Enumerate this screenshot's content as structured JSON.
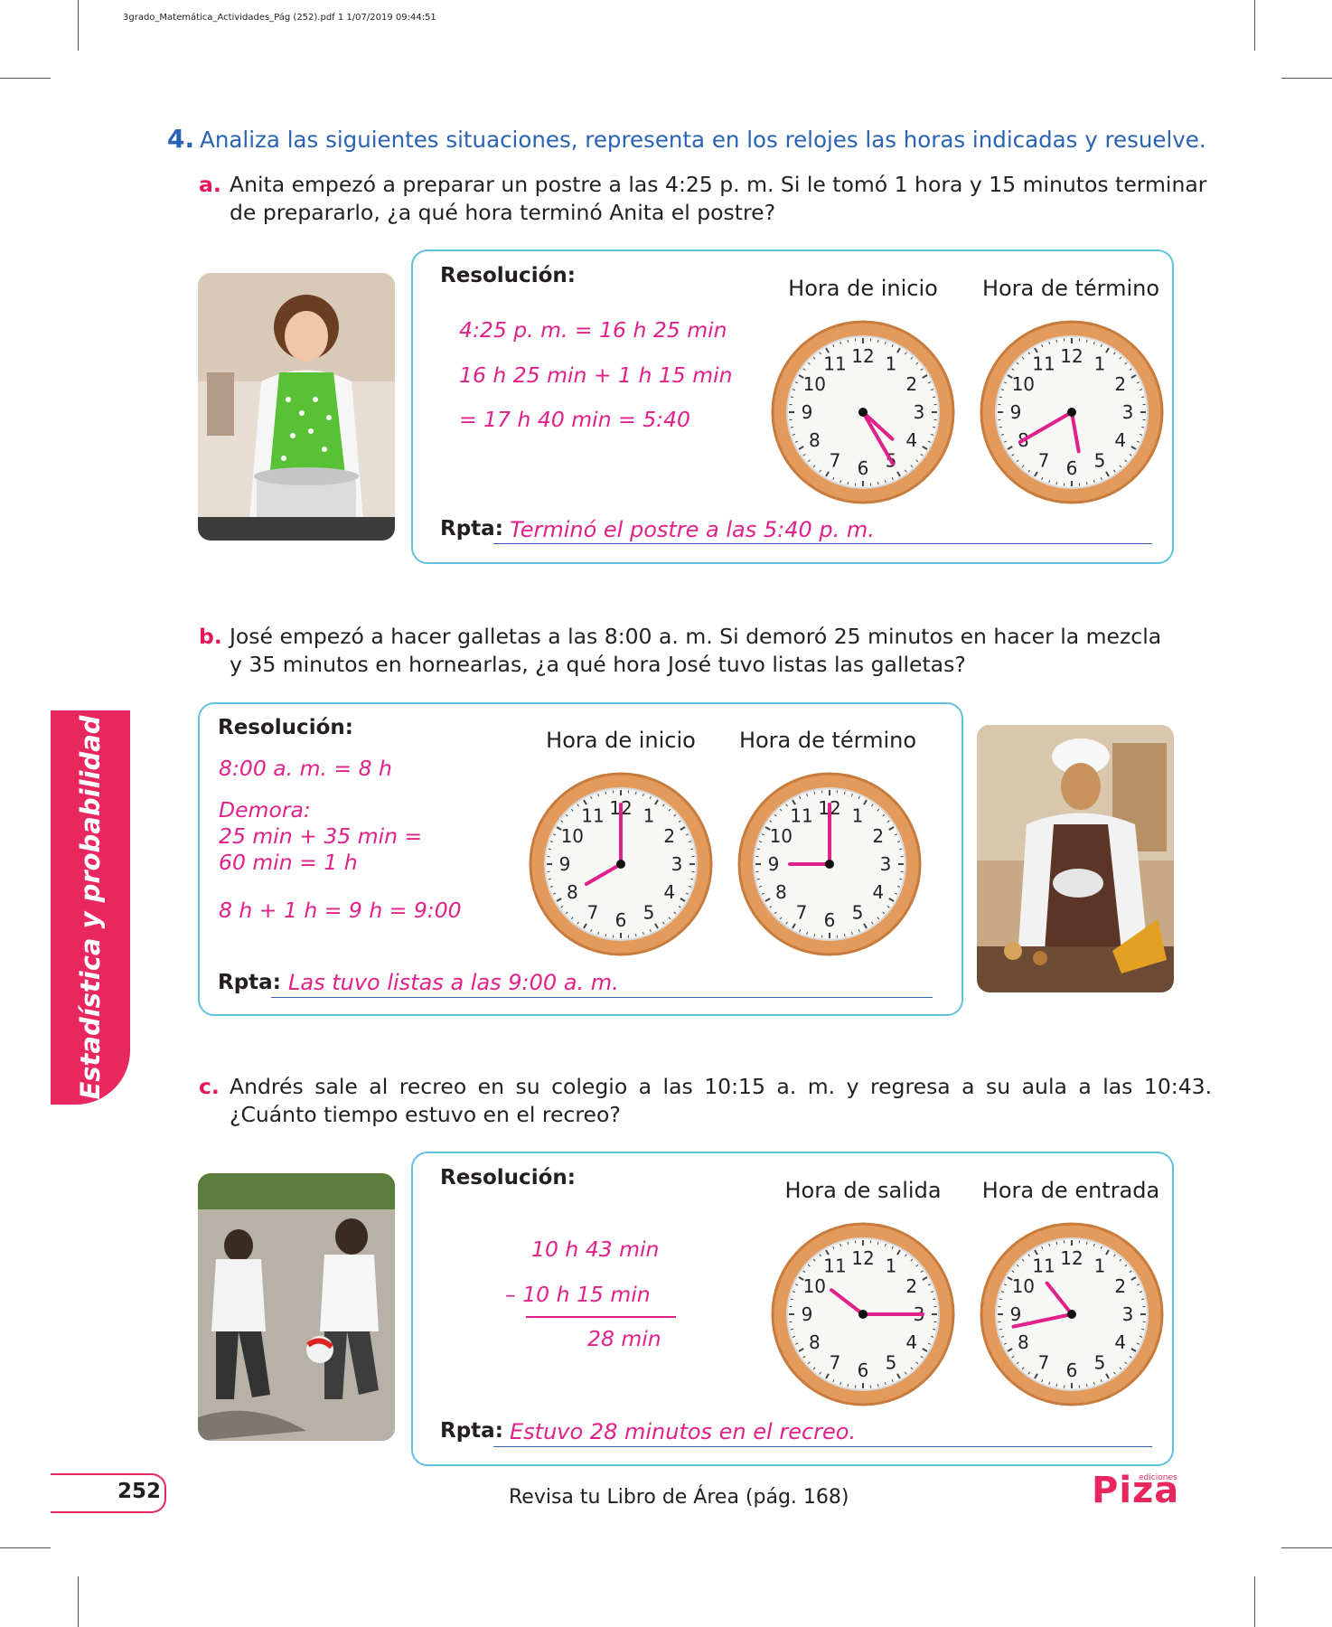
{
  "header_meta": "3grado_Matemática_Actividades_Pág (252).pdf   1   1/07/2019   09:44:51",
  "question": {
    "number": "4.",
    "title": "Analiza las siguientes situaciones, representa en los relojes las horas indicadas y resuelve."
  },
  "items": [
    {
      "letter": "a.",
      "statement_1": "Anita empezó a preparar un postre a las 4:25 p. m. Si le tomó 1 hora y 15 minutos terminar",
      "statement_2": "de prepararlo, ¿a qué hora terminó Anita el postre?",
      "resolution_label": "Resolución:",
      "work": [
        "4:25 p. m. = 16 h 25 min",
        "16 h 25 min + 1 h 15 min",
        "= 17 h 40 min = 5:40"
      ],
      "clock_1": {
        "caption": "Hora de inicio",
        "hour": 4,
        "minute": 25
      },
      "clock_2": {
        "caption": "Hora de término",
        "hour": 5,
        "minute": 40
      },
      "answer_label": "Rpta:",
      "answer": "Terminó el postre a las 5:40 p. m."
    },
    {
      "letter": "b.",
      "statement_1": "José empezó a hacer galletas a las 8:00 a. m. Si demoró 25 minutos en hacer la mezcla",
      "statement_2": "y 35 minutos en hornearlas, ¿a qué hora José tuvo listas las galletas?",
      "resolution_label": "Resolución:",
      "work": [
        "8:00 a. m. = 8 h",
        "Demora:",
        "25 min + 35 min =",
        "60 min = 1 h",
        "8 h + 1 h = 9 h = 9:00"
      ],
      "clock_1": {
        "caption": "Hora de inicio",
        "hour": 8,
        "minute": 0
      },
      "clock_2": {
        "caption": "Hora de término",
        "hour": 9,
        "minute": 0
      },
      "answer_label": "Rpta:",
      "answer": "Las tuvo listas a las 9:00 a. m."
    },
    {
      "letter": "c.",
      "statement_1": "Andrés sale al recreo en su colegio a las 10:15 a. m. y regresa a su aula a las 10:43.",
      "statement_2": "¿Cuánto tiempo estuvo en el recreo?",
      "resolution_label": "Resolución:",
      "work": [
        "10 h  43 min",
        "–  10 h  15 min",
        "28 min"
      ],
      "clock_1": {
        "caption": "Hora de salida",
        "hour": 10,
        "minute": 15
      },
      "clock_2": {
        "caption": "Hora de entrada",
        "hour": 10,
        "minute": 43
      },
      "answer_label": "Rpta:",
      "answer": "Estuvo 28 minutos en el recreo."
    }
  ],
  "side_tab": "Estadística y probabilidad",
  "page_number": "252",
  "footer": "Revisa tu Libro de Área (pág. 168)",
  "logo": {
    "word": "Piza",
    "sub": "ediciones"
  },
  "colors": {
    "accent_pink": "#e8275f",
    "answer_magenta": "#e0218a",
    "title_blue": "#2b63b4",
    "box_border": "#5ec2dd",
    "clock_rim": "#e39a5a"
  },
  "clock_numbers": [
    "12",
    "1",
    "2",
    "3",
    "4",
    "5",
    "6",
    "7",
    "8",
    "9",
    "10",
    "11"
  ]
}
